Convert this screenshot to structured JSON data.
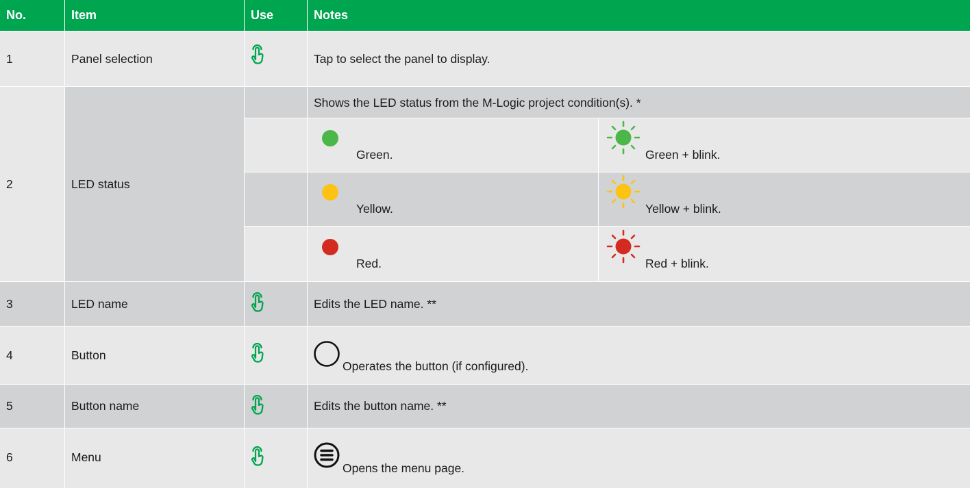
{
  "headers": {
    "no": "No.",
    "item": "Item",
    "use": "Use",
    "notes": "Notes"
  },
  "rows": [
    {
      "no": "1",
      "item": "Panel selection",
      "use_icon": "tap-hand-icon",
      "note": "Tap to select the panel to display."
    },
    {
      "no": "2",
      "item": "LED status",
      "note": "Shows the LED status from the M-Logic project condition(s). *",
      "leds": [
        {
          "label": "Green.",
          "blink_label": "Green + blink.",
          "color": "#4cb749"
        },
        {
          "label": "Yellow.",
          "blink_label": "Yellow + blink.",
          "color": "#fcc315"
        },
        {
          "label": "Red.",
          "blink_label": "Red + blink.",
          "color": "#d42b20"
        }
      ]
    },
    {
      "no": "3",
      "item": "LED name",
      "use_icon": "tap-hand-icon",
      "note": "Edits the LED name. **"
    },
    {
      "no": "4",
      "item": "Button",
      "use_icon": "tap-hand-icon",
      "note_icon": "circle-button-icon",
      "note": "Operates the button (if configured)."
    },
    {
      "no": "5",
      "item": "Button name",
      "use_icon": "tap-hand-icon",
      "note": "Edits the button name. **"
    },
    {
      "no": "6",
      "item": "Menu",
      "use_icon": "tap-hand-icon",
      "note_icon": "menu-icon",
      "note": "Opens the menu page."
    }
  ],
  "colors": {
    "header": "#00a54f",
    "row_light": "#e8e8e9",
    "row_dark": "#d1d2d4",
    "hand": "#00a54f"
  }
}
